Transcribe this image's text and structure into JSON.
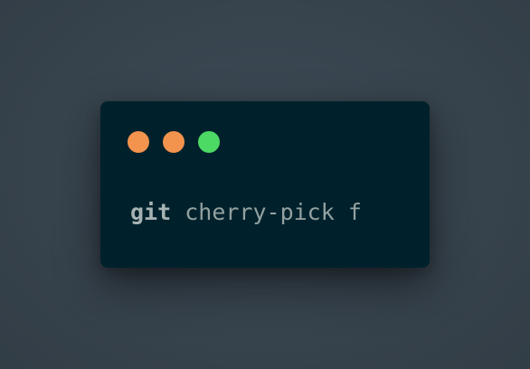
{
  "terminal": {
    "window_controls": [
      {
        "name": "close",
        "color": "#f2934e"
      },
      {
        "name": "minimize",
        "color": "#f2934e"
      },
      {
        "name": "maximize",
        "color": "#4cd964"
      }
    ],
    "command": {
      "program": "git",
      "arguments": "cherry-pick f"
    },
    "background_color": "#00212b"
  }
}
